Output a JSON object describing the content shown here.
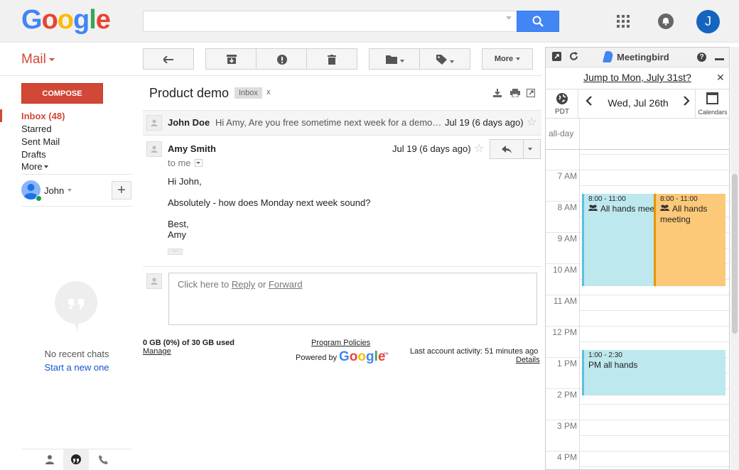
{
  "header": {
    "logo": "Google",
    "search": {
      "value": "",
      "placeholder": ""
    },
    "avatar_initial": "J"
  },
  "nav": {
    "mail_label": "Mail",
    "compose_label": "COMPOSE",
    "items": [
      {
        "label": "Inbox (48)"
      },
      {
        "label": "Starred"
      },
      {
        "label": "Sent Mail"
      },
      {
        "label": "Drafts"
      },
      {
        "label": "More"
      }
    ],
    "chat_user": "John",
    "add_label": "+",
    "no_chats": "No recent chats",
    "start_new": "Start a new one"
  },
  "toolbar": {
    "more_label": "More"
  },
  "thread": {
    "subject": "Product demo",
    "label": "Inbox",
    "label_remove": "x",
    "collapsed": {
      "sender": "John Doe",
      "snippet": "Hi Amy, Are you free sometime next week for a demo…",
      "date": "Jul 19 (6 days ago)"
    },
    "expanded": {
      "sender": "Amy Smith",
      "date": "Jul 19 (6 days ago)",
      "to": "to me",
      "body": [
        "Hi John,",
        "Absolutely - how does Monday next week sound?",
        "Best,",
        "Amy"
      ],
      "trimmed": "···"
    },
    "reply_prompt": {
      "prefix": "Click here to ",
      "reply": "Reply",
      "or": " or ",
      "forward": "Forward"
    }
  },
  "footer": {
    "storage": "0 GB (0%) of 30 GB used",
    "manage": "Manage",
    "program_policies": "Program Policies",
    "powered_by": "Powered by",
    "powered_logo": "Google",
    "tm": "™",
    "last_activity": "Last account activity: 51 minutes ago",
    "details": "Details"
  },
  "meetingbird": {
    "title": "Meetingbird",
    "help": "?",
    "jump_link": "Jump to Mon, July 31st?",
    "close": "✕",
    "timezone": "PDT",
    "date": "Wed, Jul 26th",
    "calendars_label": "Calendars",
    "all_day": "all-day",
    "hours": [
      "7 AM",
      "8 AM",
      "9 AM",
      "10 AM",
      "11 AM",
      "12 PM",
      "1 PM",
      "2 PM",
      "3 PM",
      "4 PM"
    ],
    "events": [
      {
        "time": "8:00 - 11:00",
        "name": "All hands meeting",
        "color": "#bde8ee",
        "border": "#5bc0de"
      },
      {
        "time": "8:00 - 11:00",
        "name": "All hands meeting",
        "color": "#fcc979",
        "border": "#e69500"
      },
      {
        "time": "1:00 - 2:30",
        "name": "PM all hands",
        "color": "#bde8ee",
        "border": "#5bc0de"
      }
    ]
  },
  "colors": {
    "accent_red": "#d14836",
    "link_blue": "#1155cc",
    "search_blue": "#4285f4"
  }
}
